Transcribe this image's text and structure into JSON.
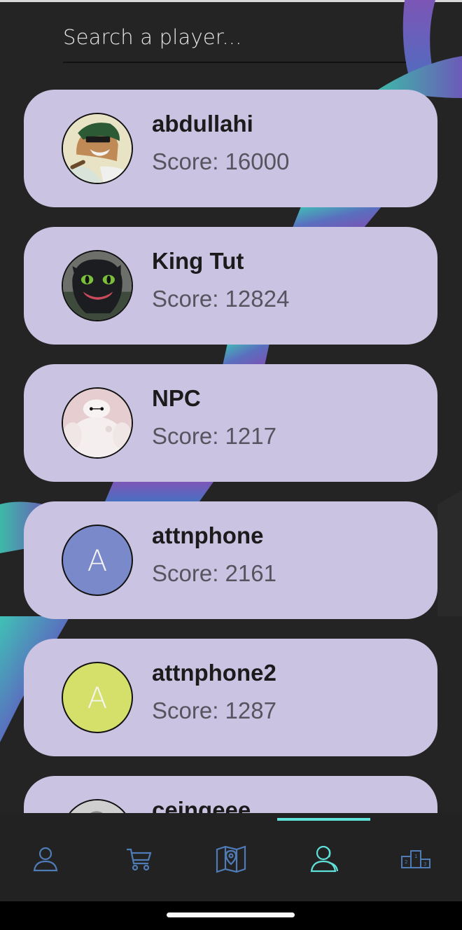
{
  "search": {
    "placeholder": "Search a player..."
  },
  "players": [
    {
      "name": "abdullahi",
      "score": "Score: 16000",
      "avatar": "photo-anime-character"
    },
    {
      "name": "King Tut",
      "score": "Score: 12824",
      "avatar": "photo-black-dragon"
    },
    {
      "name": "NPC",
      "score": "Score: 1217",
      "avatar": "photo-white-robot"
    },
    {
      "name": "attnphone",
      "score": "Score: 2161",
      "avatar_letter": "A",
      "avatar_color": "#7a89c9"
    },
    {
      "name": "attnphone2",
      "score": "Score: 1287",
      "avatar_letter": "A",
      "avatar_color": "#d5e06a"
    },
    {
      "name": "ceingeee",
      "score": "",
      "avatar": "photo-grayscale-person"
    }
  ],
  "nav": {
    "items": [
      "profile-icon",
      "cart-icon",
      "map-icon",
      "players-icon",
      "leaderboard-icon"
    ],
    "active": "players-icon",
    "active_color": "#5fe0d8",
    "inactive_color": "#4f7bb6"
  },
  "colors": {
    "background": "#242424",
    "card": "#cbc3e2",
    "name_text": "#1b1b1b",
    "score_text": "#57535f"
  }
}
